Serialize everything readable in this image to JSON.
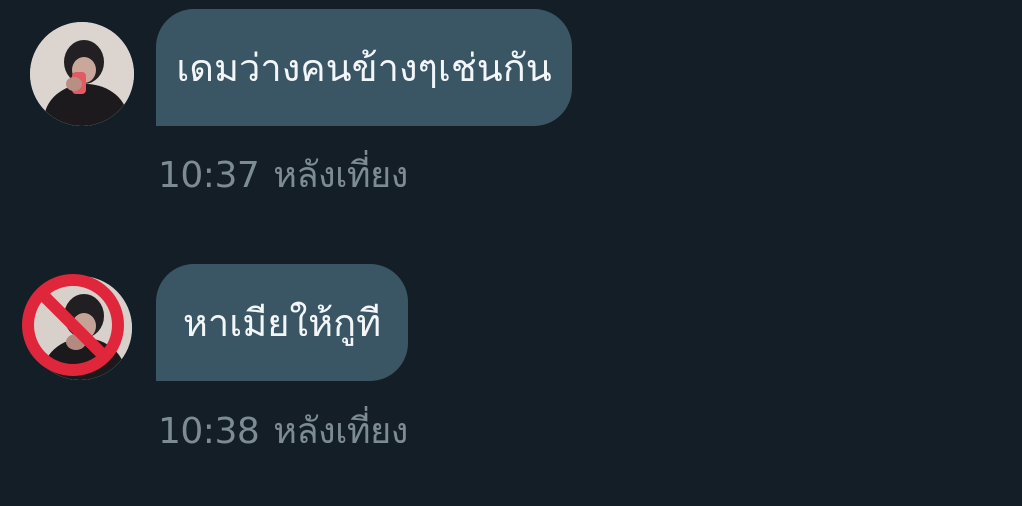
{
  "messages": [
    {
      "text": "เดมว่างคนข้างๆเช่นกัน",
      "time": "10:37",
      "period": "หลังเที่ยง",
      "avatar_icon": "profile-photo",
      "blocked": false
    },
    {
      "text": "หาเมียให้กูที",
      "time": "10:38",
      "period": "หลังเที่ยง",
      "avatar_icon": "profile-photo",
      "blocked": true,
      "blocked_icon": "no-entry-icon"
    }
  ],
  "colors": {
    "background": "#131e26",
    "bubble": "#3a5665",
    "bubble_text": "#f2f6f8",
    "meta_text": "#7c8b94",
    "block_red": "#e0263a"
  }
}
